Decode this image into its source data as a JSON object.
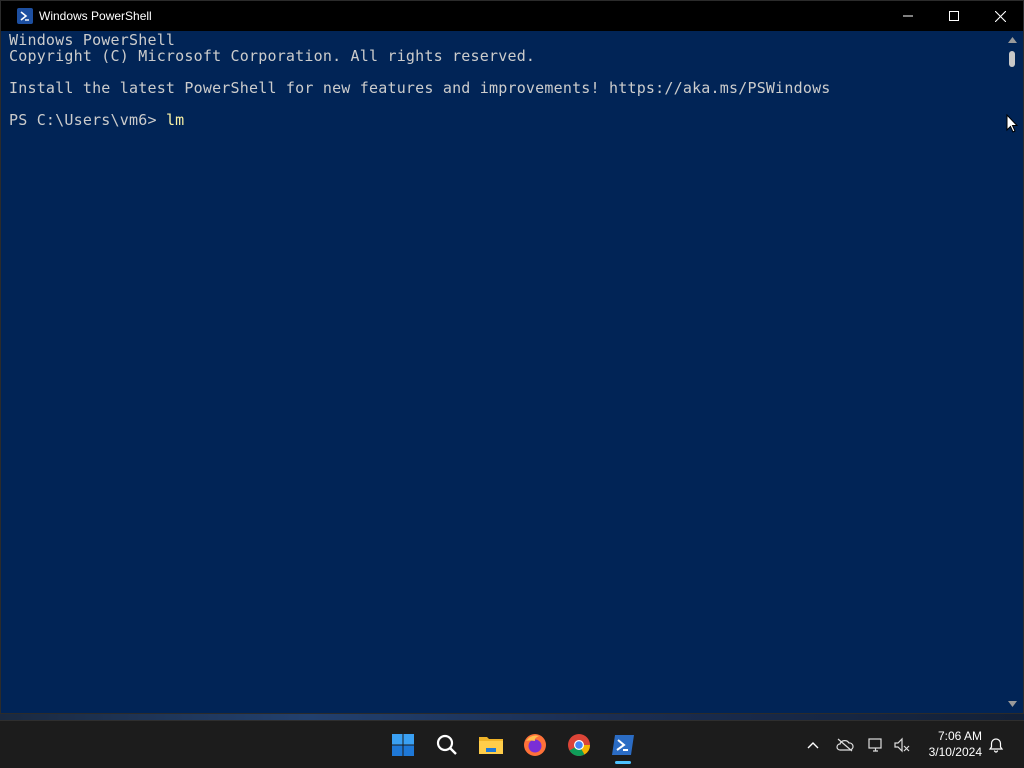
{
  "window": {
    "title": "Windows PowerShell",
    "controls": [
      "minimize",
      "maximize",
      "close"
    ]
  },
  "console": {
    "lines": [
      "Windows PowerShell",
      "Copyright (C) Microsoft Corporation. All rights reserved.",
      "Install the latest PowerShell for new features and improvements! https://aka.ms/PSWindows"
    ],
    "prompt": "PS C:\\Users\\vm6> ",
    "command": "lm"
  },
  "colors": {
    "console_background": "#012456",
    "console_text": "#cccccc",
    "command_text": "#f9f1a5",
    "titlebar": "#000000",
    "taskbar": "#1c1c1c",
    "accent": "#4cc2ff"
  },
  "taskbar": {
    "apps": [
      "start-icon",
      "search-icon",
      "file-explorer-icon",
      "firefox-icon",
      "chrome-icon",
      "powershell-icon"
    ],
    "active_app": "powershell-icon",
    "tray": [
      "chevron-up-icon",
      "cloud-offline-icon",
      "network-icon",
      "volume-muted-icon"
    ],
    "time": "7:06 AM",
    "date": "3/10/2024",
    "notification_icon": "bell-icon"
  }
}
